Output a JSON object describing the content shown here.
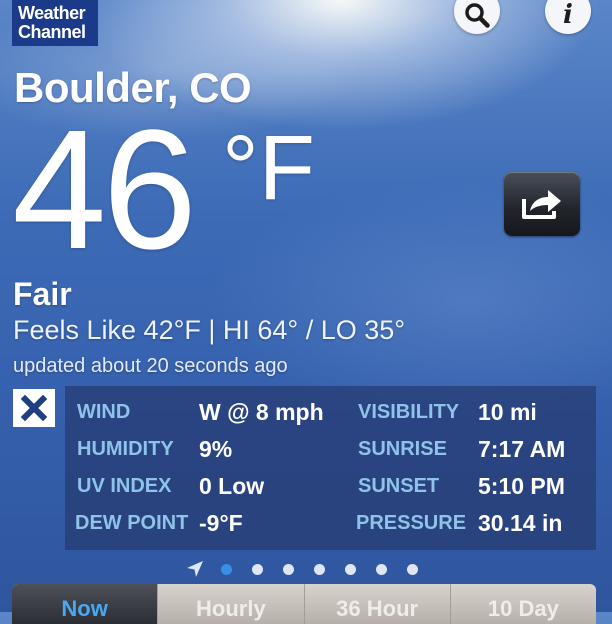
{
  "app": {
    "logo_line1": "Weather",
    "logo_line2": "Channel"
  },
  "location": "Boulder, CO",
  "current": {
    "temperature": "46",
    "unit": "°F",
    "condition": "Fair",
    "feels_like_line": "Feels Like 42°F | HI 64° / LO 35°",
    "updated": "updated about 20 seconds ago"
  },
  "details": [
    {
      "label": "WIND",
      "value": "W @ 8 mph"
    },
    {
      "label": "VISIBILITY",
      "value": "10 mi"
    },
    {
      "label": "HUMIDITY",
      "value": "9%"
    },
    {
      "label": "SUNRISE",
      "value": "7:17 AM"
    },
    {
      "label": "UV INDEX",
      "value": "0 Low"
    },
    {
      "label": "SUNSET",
      "value": "5:10 PM"
    },
    {
      "label": "DEW POINT",
      "value": "-9°F"
    },
    {
      "label": "PRESSURE",
      "value": "30.14 in"
    }
  ],
  "pager": {
    "count": 7,
    "active_index": 0
  },
  "tabs": [
    {
      "label": "Now",
      "active": true
    },
    {
      "label": "Hourly",
      "active": false
    },
    {
      "label": "36 Hour",
      "active": false
    },
    {
      "label": "10 Day",
      "active": false
    }
  ],
  "colors": {
    "sky": "#3d6bb6",
    "label_blue": "#8fc3ea",
    "active_tab_text": "#4aa8f2",
    "pager_active": "#3a8ee6"
  },
  "icons": {
    "search": "search-icon",
    "info": "info-icon",
    "share": "share-icon",
    "close": "close-icon",
    "location": "location-arrow-icon"
  }
}
